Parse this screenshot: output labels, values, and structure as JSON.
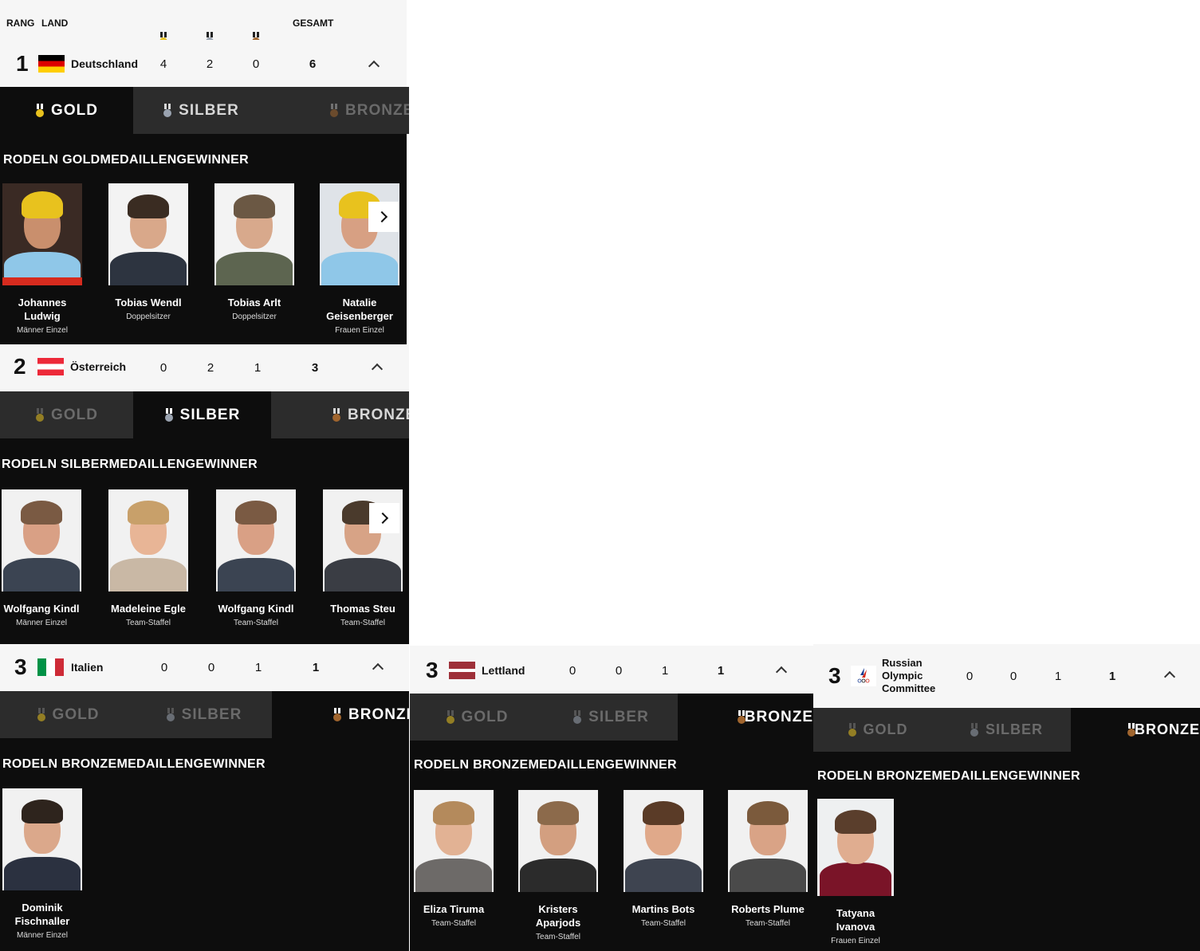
{
  "header": {
    "rang": "RANG",
    "land": "LAND",
    "gesamt": "GESAMT"
  },
  "tabs": {
    "gold": "GOLD",
    "silber": "SILBER",
    "bronze": "BRONZE"
  },
  "colors": {
    "gold": "#e8c21e",
    "silver": "#9aa3b0",
    "bronze": "#a0652e",
    "dark": "#0d0d0d",
    "tab_inactive": "#2c2c2c",
    "row_bg": "#f6f6f6"
  },
  "rows": [
    {
      "rank": "1",
      "country": "Deutschland",
      "gold": "4",
      "silver": "2",
      "bronze": "0",
      "total": "6",
      "flag": "germany-flag"
    },
    {
      "rank": "2",
      "country": "Österreich",
      "gold": "0",
      "silver": "2",
      "bronze": "1",
      "total": "3",
      "flag": "austria-flag"
    },
    {
      "rank": "3",
      "country": "Italien",
      "gold": "0",
      "silver": "0",
      "bronze": "1",
      "total": "1",
      "flag": "italy-flag"
    },
    {
      "rank": "3",
      "country": "Lettland",
      "gold": "0",
      "silver": "0",
      "bronze": "1",
      "total": "1",
      "flag": "latvia-flag"
    },
    {
      "rank": "3",
      "country": "Russian Olympic Committee",
      "gold": "0",
      "silver": "0",
      "bronze": "1",
      "total": "1",
      "flag": "roc-flag"
    }
  ],
  "sections": {
    "germany": "RODELN GOLDMEDAILLENGEWINNER",
    "austria": "RODELN SILBERMEDAILLENGEWINNER",
    "italy": "RODELN BRONZEMEDAILLENGEWINNER",
    "latvia": "RODELN BRONZEMEDAILLENGEWINNER",
    "roc": "RODELN BRONZEMEDAILLENGEWINNER"
  },
  "athletes": {
    "germany": [
      {
        "name": "Johannes Ludwig",
        "event": "Männer Einzel"
      },
      {
        "name": "Tobias Wendl",
        "event": "Doppelsitzer"
      },
      {
        "name": "Tobias Arlt",
        "event": "Doppelsitzer"
      },
      {
        "name": "Natalie Geisenberger",
        "event": "Frauen Einzel"
      }
    ],
    "austria": [
      {
        "name": "Wolfgang Kindl",
        "event": "Männer Einzel"
      },
      {
        "name": "Madeleine Egle",
        "event": "Team-Staffel"
      },
      {
        "name": "Wolfgang Kindl",
        "event": "Team-Staffel"
      },
      {
        "name": "Thomas Steu",
        "event": "Team-Staffel"
      }
    ],
    "italy": [
      {
        "name": "Dominik Fischnaller",
        "event": "Männer Einzel"
      }
    ],
    "latvia": [
      {
        "name": "Eliza Tiruma",
        "event": "Team-Staffel"
      },
      {
        "name": "Kristers Aparjods",
        "event": "Team-Staffel"
      },
      {
        "name": "Martins Bots",
        "event": "Team-Staffel"
      },
      {
        "name": "Roberts Plume",
        "event": "Team-Staffel"
      }
    ],
    "roc": [
      {
        "name": "Tatyana Ivanova",
        "event": "Frauen Einzel"
      }
    ]
  }
}
